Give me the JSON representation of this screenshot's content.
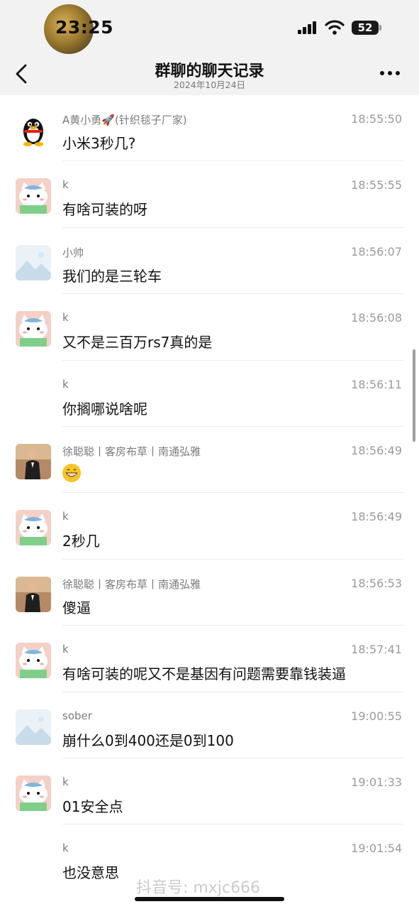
{
  "status_bar": {
    "time": "23:25",
    "battery": "52"
  },
  "nav": {
    "title": "群聊的聊天记录",
    "subtitle": "2024年10月24日"
  },
  "messages": [
    {
      "name": "A黄小勇🚀(针织毯子厂家)",
      "time": "18:55:50",
      "text": "小米3秒几?",
      "avatar": "penguin-avatar"
    },
    {
      "name": "k",
      "time": "18:55:55",
      "text": "有啥可装的呀",
      "avatar": "cat-avatar"
    },
    {
      "name": "小帅",
      "time": "18:56:07",
      "text": "我们的是三轮车",
      "avatar": "placeholder-avatar"
    },
    {
      "name": "k",
      "time": "18:56:08",
      "text": "又不是三百万rs7真的是",
      "avatar": "cat-avatar"
    },
    {
      "name": "k",
      "time": "18:56:11",
      "text": "你搁哪说啥呢",
      "avatar": "none"
    },
    {
      "name": "徐聪聪丨客房布草丨南通弘雅",
      "time": "18:56:49",
      "text": "",
      "avatar": "photo-avatar"
    },
    {
      "name": "k",
      "time": "18:56:49",
      "text": "2秒几",
      "avatar": "cat-avatar"
    },
    {
      "name": "徐聪聪丨客房布草丨南通弘雅",
      "time": "18:56:53",
      "text": "傻逼",
      "avatar": "photo-avatar"
    },
    {
      "name": "k",
      "time": "18:57:41",
      "text": "有啥可装的呢又不是基因有问题需要靠钱装逼",
      "avatar": "cat-avatar"
    },
    {
      "name": "sober",
      "time": "19:00:55",
      "text": "崩什么0到400还是0到100",
      "avatar": "placeholder-avatar"
    },
    {
      "name": "k",
      "time": "19:01:33",
      "text": "01安全点",
      "avatar": "cat-avatar"
    },
    {
      "name": "k",
      "time": "19:01:54",
      "text": "也没意思",
      "avatar": "none"
    }
  ],
  "watermark": "抖音号: mxjc666",
  "colors": {
    "header_bg": "#f2f2f2",
    "name_text": "#7b7b7b",
    "time_text": "#9a9a9a"
  }
}
